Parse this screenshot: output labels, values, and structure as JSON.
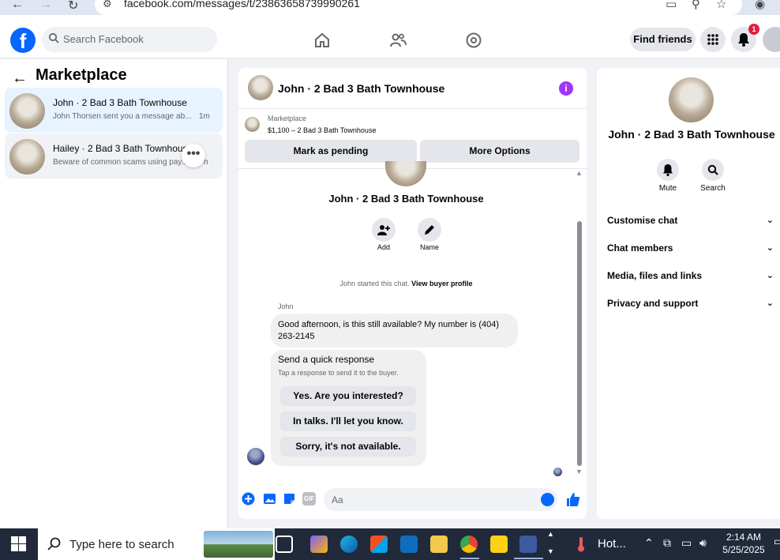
{
  "browser": {
    "url": "facebook.com/messages/t/23863658739990261"
  },
  "header": {
    "logo": "f",
    "search_placeholder": "Search Facebook",
    "find_friends": "Find friends",
    "notification_count": "1",
    "icons": [
      "home-icon",
      "friends-icon",
      "gaming-icon",
      "menu-grid-icon",
      "bell-icon",
      "profile-avatar"
    ]
  },
  "left_panel": {
    "title": "Marketplace",
    "conversations": [
      {
        "name": "John · 2 Bad 3 Bath Townhouse",
        "preview": "John Thorsen sent you a message ab...",
        "time": "1m"
      },
      {
        "name": "Hailey · 2 Bad 3 Bath Townhouse",
        "preview": "Beware of common scams using pay...",
        "preview_tail": "h",
        "more_label": "•••"
      }
    ]
  },
  "chat": {
    "title": "John · 2 Bad 3 Bath Townhouse",
    "listing": {
      "label": "Marketplace",
      "price": "$1,100 – 2 Bad 3 Bath Townhouse",
      "mark_pending": "Mark as pending",
      "more_options": "More Options"
    },
    "profile_name": "John · 2 Bad 3 Bath Townhouse",
    "actions": [
      {
        "label": "Add",
        "icon": "add-person-icon"
      },
      {
        "label": "Name",
        "icon": "pencil-icon"
      }
    ],
    "started_text": "John started this chat.",
    "view_buyer": "View buyer profile",
    "sender": "John",
    "message": "Good afternoon, is this still available? My number is (404) 263-2145",
    "quick_response": {
      "title": "Send a quick response",
      "subtitle": "Tap a response to send it to the buyer.",
      "options": [
        "Yes. Are you interested?",
        "In talks. I'll let you know.",
        "Sorry, it's not available."
      ]
    },
    "composer_placeholder": "Aa",
    "composer_icons": [
      "plus-icon",
      "photo-icon",
      "sticker-icon",
      "gif-icon",
      "emoji-icon",
      "like-icon"
    ],
    "gif_label": "GIF"
  },
  "right_panel": {
    "name": "John · 2 Bad 3 Bath Townhouse",
    "buttons": [
      {
        "label": "Mute",
        "icon": "bell-icon"
      },
      {
        "label": "Search",
        "icon": "search-icon"
      }
    ],
    "sections": [
      "Customise chat",
      "Chat members",
      "Media, files and links",
      "Privacy and support"
    ]
  },
  "taskbar": {
    "search_placeholder": "Type here to search",
    "weather": "Hot...",
    "time": "2:14 AM",
    "date": "5/25/2025"
  },
  "colors": {
    "brand": "#0866ff",
    "info": "#a334fa",
    "badge": "#e41e3f"
  }
}
